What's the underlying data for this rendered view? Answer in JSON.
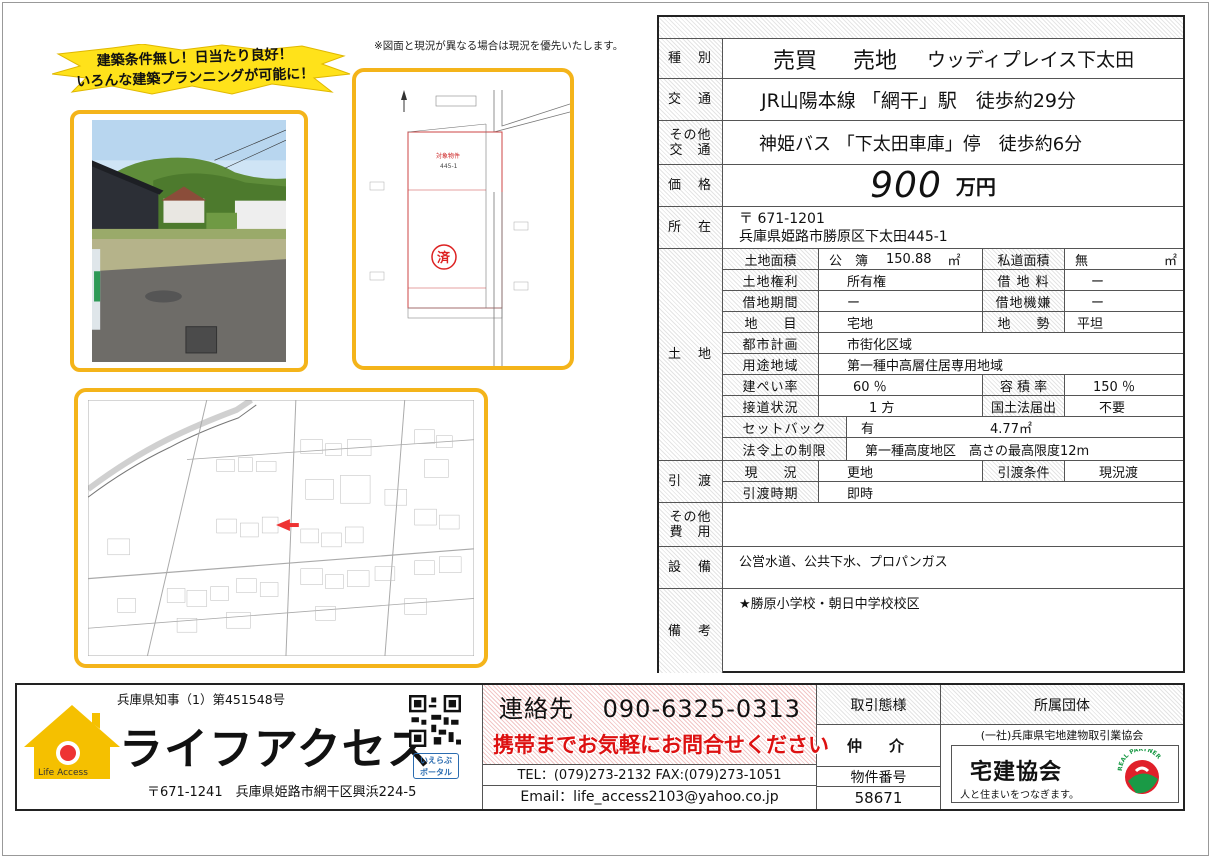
{
  "banner": {
    "line1": "建築条件無し！日当たり良好！",
    "line2": "いろんな建築プランニングが可能に！"
  },
  "notice": "※図面と現況が異なる場合は現況を優先いたします。",
  "plan": {
    "target_label": "対象物件",
    "lot": "445-1",
    "sold_mark": "済"
  },
  "spec": {
    "type": {
      "label": "種　別",
      "deal": "売買",
      "kind": "売地",
      "name": "ウッディプレイス下太田"
    },
    "access": {
      "label": "交　通",
      "value": "JR山陽本線 「網干」駅　徒歩約29分"
    },
    "access_other": {
      "label_1": "その他",
      "label_2": "交　通",
      "value": "神姫バス 「下太田車庫」停　徒歩約6分"
    },
    "price": {
      "label": "価　格",
      "amount": "900",
      "unit": "万円"
    },
    "location": {
      "label": "所　在",
      "zip": "〒 671-1201",
      "address": "兵庫県姫路市勝原区下太田445-1"
    },
    "land": {
      "label": "土　地",
      "area_label": "土地面積",
      "area_basis": "公　簿",
      "area_value": "150.88",
      "area_unit": "㎡",
      "private_road_label": "私道面積",
      "private_road_value": "無",
      "private_road_unit": "㎡",
      "rights_label": "土地権利",
      "rights_value": "所有権",
      "rent_label": "借 地 料",
      "rent_value": "ー",
      "lease_term_label": "借地期間",
      "lease_term_value": "ー",
      "lease_type_label": "借地機嫌",
      "lease_type_value": "ー",
      "category_label": "地　　目",
      "category_value": "宅地",
      "terrain_label": "地　　勢",
      "terrain_value": "平坦",
      "city_plan_label": "都市計画",
      "city_plan_value": "市街化区域",
      "zoning_label": "用途地域",
      "zoning_value": "第一種中高層住居専用地域",
      "coverage_label": "建ぺい率",
      "coverage_value": "60 ％",
      "far_label": "容 積 率",
      "far_value": "150 ％",
      "road_label": "接道状況",
      "road_value": "1 方",
      "notify_label": "国土法届出",
      "notify_value": "不要",
      "setback_label": "セットバック",
      "setback_value": "有",
      "setback_size": "4.77㎡",
      "legal_label": "法令上の制限",
      "legal_value": "第一種高度地区　高さの最高限度12m"
    },
    "handover": {
      "label": "引　渡",
      "status_label": "現　　況",
      "status_value": "更地",
      "cond_label": "引渡条件",
      "cond_value": "現況渡",
      "time_label": "引渡時期",
      "time_value": "即時"
    },
    "other_cost": {
      "label_1": "その他",
      "label_2": "費　用",
      "value": ""
    },
    "facilities": {
      "label": "設　備",
      "value": "公営水道、公共下水、プロパンガス"
    },
    "remarks": {
      "label": "備　考",
      "value": "★勝原小学校・朝日中学校校区"
    }
  },
  "footer": {
    "license": "兵庫県知事（1）第451548号",
    "brand": "ライフアクセス",
    "logo_text": "Life Access",
    "address": "〒671-1241　兵庫県姫路市網干区興浜224-5",
    "portal_1": "いえらぶ",
    "portal_2": "ポータル",
    "contact_label": "連絡先",
    "mobile": "090-6325-0313",
    "catch": "携帯までお気軽にお問合せください",
    "telfax": "TEL：(079)273-2132 FAX:(079)273-1051",
    "email": "Email：life_access2103@yahoo.co.jp",
    "deal_label": "取引態様",
    "deal_value": "仲　介",
    "property_no_label": "物件番号",
    "property_no": "58671",
    "org_label": "所属団体",
    "org_name": "(一社)兵庫県宅地建物取引業協会",
    "org_logo_title": "宅建協会",
    "org_logo_sub": "人と住まいをつなぎます。",
    "org_mark_text": "REAL PARTNER"
  },
  "colors": {
    "frame": "#f4b41a",
    "burst": "#ffe21a",
    "accent_red": "#d11111",
    "logo_yellow": "#f5c000"
  }
}
